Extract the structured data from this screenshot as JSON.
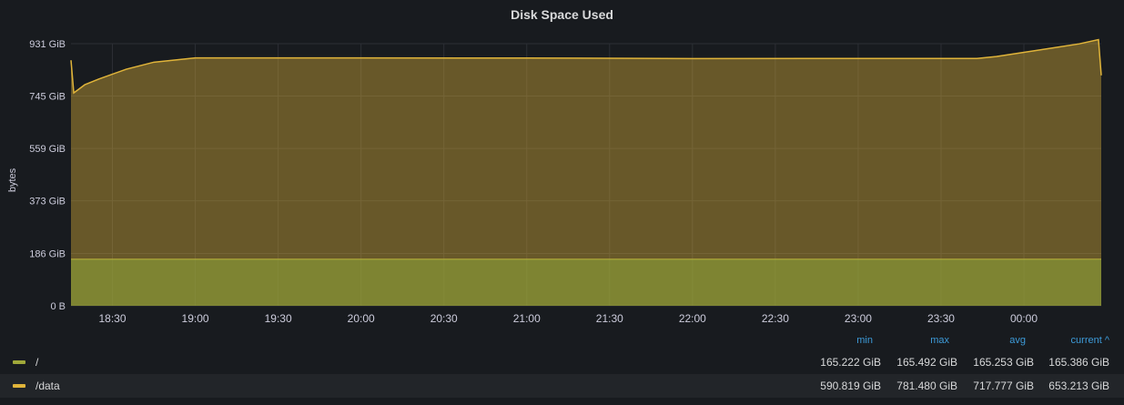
{
  "panel": {
    "title": "Disk Space Used"
  },
  "legend": {
    "headers": {
      "min": "min",
      "max": "max",
      "avg": "avg",
      "current": "current ^"
    },
    "rows": [
      {
        "name": "/",
        "color": "#a0a83a",
        "min": "165.222 GiB",
        "max": "165.492 GiB",
        "avg": "165.253 GiB",
        "current": "165.386 GiB"
      },
      {
        "name": "/data",
        "color": "#e0b43a",
        "min": "590.819 GiB",
        "max": "781.480 GiB",
        "avg": "717.777 GiB",
        "current": "653.213 GiB"
      }
    ]
  },
  "chart_data": {
    "type": "area",
    "title": "Disk Space Used",
    "ylabel": "bytes",
    "xlabel": "",
    "ylim": [
      0,
      931
    ],
    "y_unit": "GiB",
    "y_ticks": [
      {
        "value": 0,
        "label": "0 B"
      },
      {
        "value": 186,
        "label": "186 GiB"
      },
      {
        "value": 373,
        "label": "373 GiB"
      },
      {
        "value": 559,
        "label": "559 GiB"
      },
      {
        "value": 745,
        "label": "745 GiB"
      },
      {
        "value": 931,
        "label": "931 GiB"
      }
    ],
    "x_ticks": [
      "18:30",
      "19:00",
      "19:30",
      "20:00",
      "20:30",
      "21:00",
      "21:30",
      "22:00",
      "22:30",
      "23:00",
      "23:30",
      "00:00"
    ],
    "x_range": [
      "18:15",
      "00:28"
    ],
    "stacked": true,
    "grid": true,
    "series": [
      {
        "name": "/",
        "color": "#a0a83a",
        "x": [
          "18:15",
          "18:40",
          "19:30",
          "20:30",
          "21:30",
          "22:30",
          "23:30",
          "00:00",
          "00:28"
        ],
        "values": [
          165.2,
          165.3,
          165.3,
          165.3,
          165.2,
          165.3,
          165.3,
          165.3,
          165.4
        ]
      },
      {
        "name": "/data",
        "color": "#e0b43a",
        "x": [
          "18:15",
          "18:16",
          "18:20",
          "18:25",
          "18:35",
          "18:45",
          "19:00",
          "20:00",
          "21:00",
          "22:00",
          "23:00",
          "23:43",
          "23:50",
          "00:00",
          "00:10",
          "00:20",
          "00:27",
          "00:28"
        ],
        "values": [
          707,
          591,
          620,
          640,
          675,
          700,
          715,
          715,
          715,
          713,
          713,
          713,
          720,
          735,
          750,
          765,
          780,
          653
        ]
      }
    ]
  }
}
